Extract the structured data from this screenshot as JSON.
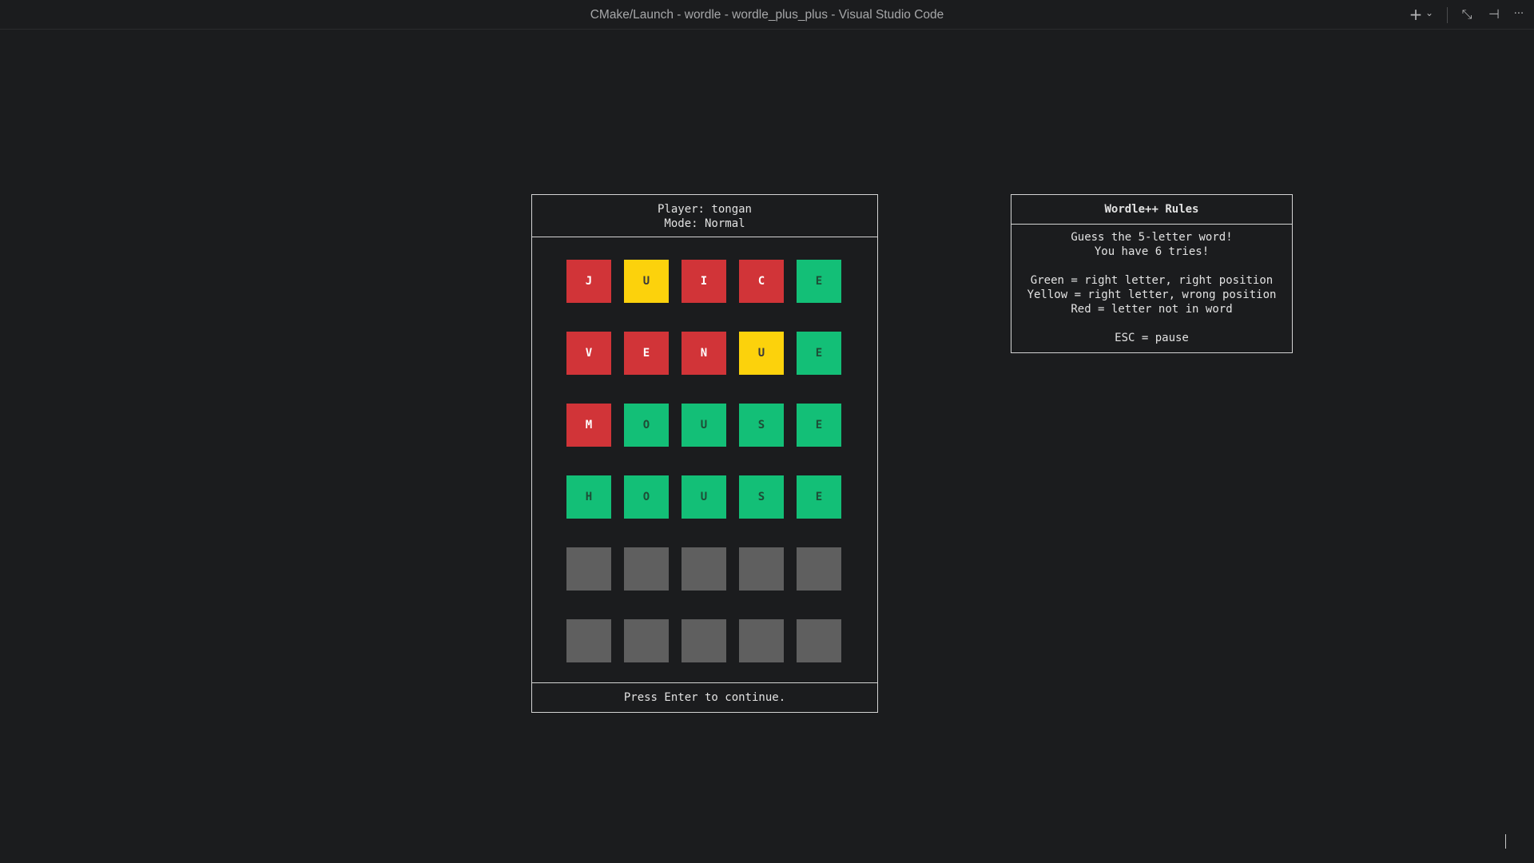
{
  "window": {
    "title": "CMake/Launch - wordle - wordle_plus_plus - Visual Studio Code",
    "icons": [
      "plus-icon",
      "chevron-down-icon",
      "exit-fullscreen-icon",
      "pin-icon",
      "more-icon"
    ],
    "icon_glyphs": {
      "plus": "+",
      "chevron": "⌄",
      "restore": "⤡",
      "pin": "⊣",
      "more": "···"
    }
  },
  "game": {
    "player_label": "Player: tongan",
    "mode_label": "Mode: Normal",
    "board": [
      [
        {
          "letter": "J",
          "state": "red"
        },
        {
          "letter": "U",
          "state": "yellow"
        },
        {
          "letter": "I",
          "state": "red"
        },
        {
          "letter": "C",
          "state": "red"
        },
        {
          "letter": "E",
          "state": "green"
        }
      ],
      [
        {
          "letter": "V",
          "state": "red"
        },
        {
          "letter": "E",
          "state": "red"
        },
        {
          "letter": "N",
          "state": "red"
        },
        {
          "letter": "U",
          "state": "yellow"
        },
        {
          "letter": "E",
          "state": "green"
        }
      ],
      [
        {
          "letter": "M",
          "state": "red"
        },
        {
          "letter": "O",
          "state": "green"
        },
        {
          "letter": "U",
          "state": "green"
        },
        {
          "letter": "S",
          "state": "green"
        },
        {
          "letter": "E",
          "state": "green"
        }
      ],
      [
        {
          "letter": "H",
          "state": "green"
        },
        {
          "letter": "O",
          "state": "green"
        },
        {
          "letter": "U",
          "state": "green"
        },
        {
          "letter": "S",
          "state": "green"
        },
        {
          "letter": "E",
          "state": "green"
        }
      ],
      [
        {
          "letter": "",
          "state": "empty"
        },
        {
          "letter": "",
          "state": "empty"
        },
        {
          "letter": "",
          "state": "empty"
        },
        {
          "letter": "",
          "state": "empty"
        },
        {
          "letter": "",
          "state": "empty"
        }
      ],
      [
        {
          "letter": "",
          "state": "empty"
        },
        {
          "letter": "",
          "state": "empty"
        },
        {
          "letter": "",
          "state": "empty"
        },
        {
          "letter": "",
          "state": "empty"
        },
        {
          "letter": "",
          "state": "empty"
        }
      ]
    ],
    "footer": "Press Enter to continue."
  },
  "rules": {
    "title": "Wordle++ Rules",
    "lines": [
      "Guess the 5-letter word!",
      "You have 6 tries!",
      "",
      "Green = right letter, right position",
      "Yellow = right letter, wrong position",
      "Red = letter not in word",
      "",
      "ESC = pause"
    ]
  },
  "colors": {
    "background": "#1b1c1e",
    "red": "#d13438",
    "yellow": "#fcd20c",
    "green": "#13bf77",
    "empty": "#5f5f5f",
    "border": "#d4d4d4"
  }
}
